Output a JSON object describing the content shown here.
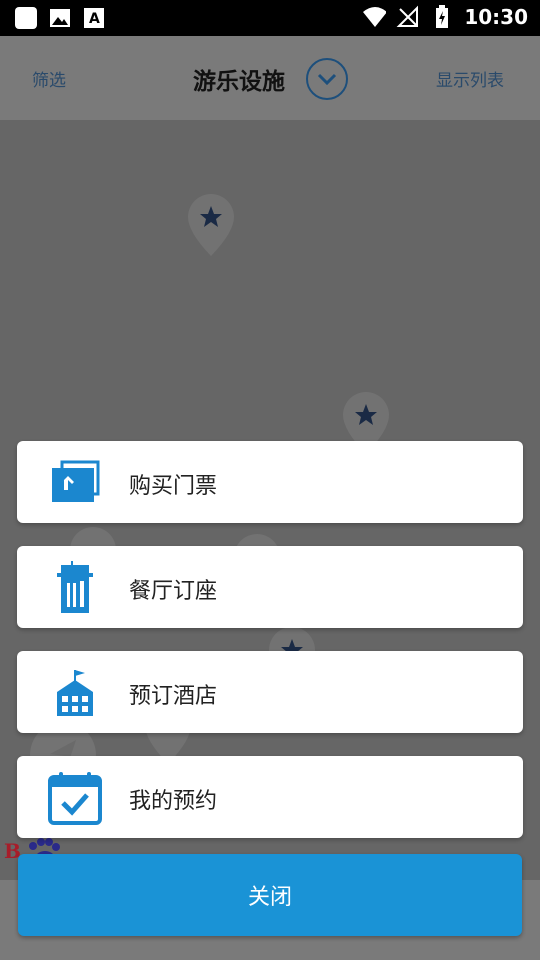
{
  "status": {
    "time": "10:30"
  },
  "header": {
    "filter_label": "筛选",
    "title": "游乐设施",
    "list_label": "显示列表"
  },
  "menu": {
    "items": [
      {
        "label": "购买门票",
        "icon": "ticket-icon"
      },
      {
        "label": "餐厅订座",
        "icon": "restaurant-icon"
      },
      {
        "label": "预订酒店",
        "icon": "hotel-icon"
      },
      {
        "label": "我的预约",
        "icon": "calendar-check-icon"
      }
    ],
    "close_label": "关闭"
  },
  "colors": {
    "accent": "#1a93d6",
    "icon_blue": "#1b87cf",
    "overlay": "#6b6b6b"
  }
}
